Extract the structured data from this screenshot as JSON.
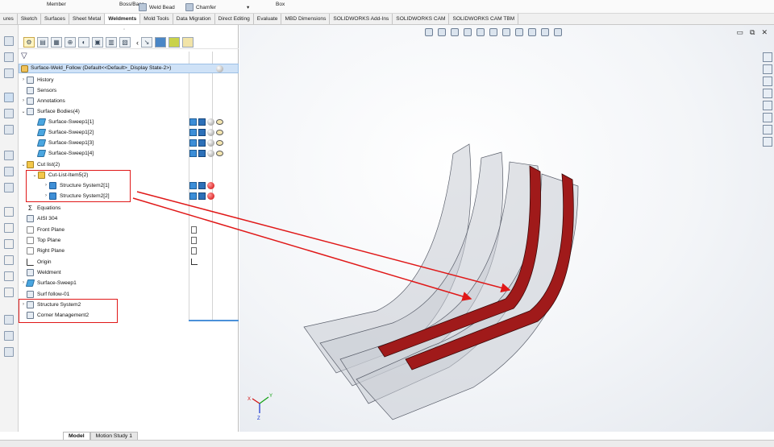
{
  "ribbon_top": {
    "member_label": "Member",
    "boss_base_label": "Boss/Base",
    "weld_bead_label": "Weld Bead",
    "chamfer_label": "Chamfer",
    "box_label": "Box",
    "dropdown_label": "▾"
  },
  "tabs": [
    {
      "label": "ures"
    },
    {
      "label": "Sketch"
    },
    {
      "label": "Surfaces"
    },
    {
      "label": "Sheet Metal"
    },
    {
      "label": "Weldments",
      "active": true
    },
    {
      "label": "Mold Tools"
    },
    {
      "label": "Data Migration"
    },
    {
      "label": "Direct Editing"
    },
    {
      "label": "Evaluate"
    },
    {
      "label": "MBD Dimensions"
    },
    {
      "label": "SOLIDWORKS Add-Ins"
    },
    {
      "label": "SOLIDWORKS CAM"
    },
    {
      "label": "SOLIDWORKS CAM TBM"
    }
  ],
  "feature_manager": {
    "root_label": "Surface-Weld_Follow  (Default<<Default>_Display State-2>)",
    "toolbar_icons": [
      "feature-manager-icon",
      "property-manager-icon",
      "configuration-manager-icon",
      "dimxpert-icon",
      "display-manager-icon",
      "cam-feature-icon",
      "cam-operation-icon",
      "cam-tool-icon"
    ],
    "collapse_arrow": "‹",
    "nodes": {
      "history": "History",
      "sensors": "Sensors",
      "annotations": "Annotations",
      "surface_bodies": "Surface Bodies(4)",
      "sweep_1": "Surface-Sweep1[1]",
      "sweep_2": "Surface-Sweep1[2]",
      "sweep_3": "Surface-Sweep1[3]",
      "sweep_4": "Surface-Sweep1[4]",
      "cut_list": "Cut list(2)",
      "cut_list_item": "Cut-List-Item5(2)",
      "structure_1": "Structure System2[1]",
      "structure_2": "Structure System2[2]",
      "equations": "Equations",
      "material": "AISI 304",
      "front_plane": "Front Plane",
      "top_plane": "Top Plane",
      "right_plane": "Right Plane",
      "origin": "Origin",
      "weldment": "Weldment",
      "surface_sweep": "Surface-Sweep1",
      "surf_follow": "Surf follow-01",
      "structure_system": "Structure System2",
      "corner_management": "Corner Management2"
    }
  },
  "bottom_tabs": {
    "model": "Model",
    "motion_study": "Motion Study 1"
  },
  "viewport": {
    "window_controls": [
      "▭",
      "⧉",
      "✕"
    ],
    "triad": {
      "x": "X",
      "y": "Y",
      "z": "Z"
    }
  },
  "colors": {
    "highlight_red": "#e01818",
    "weld_member": "#a01a1a",
    "selection_blue": "#cfe2f7",
    "surface_grey": "#c9ccd4"
  }
}
